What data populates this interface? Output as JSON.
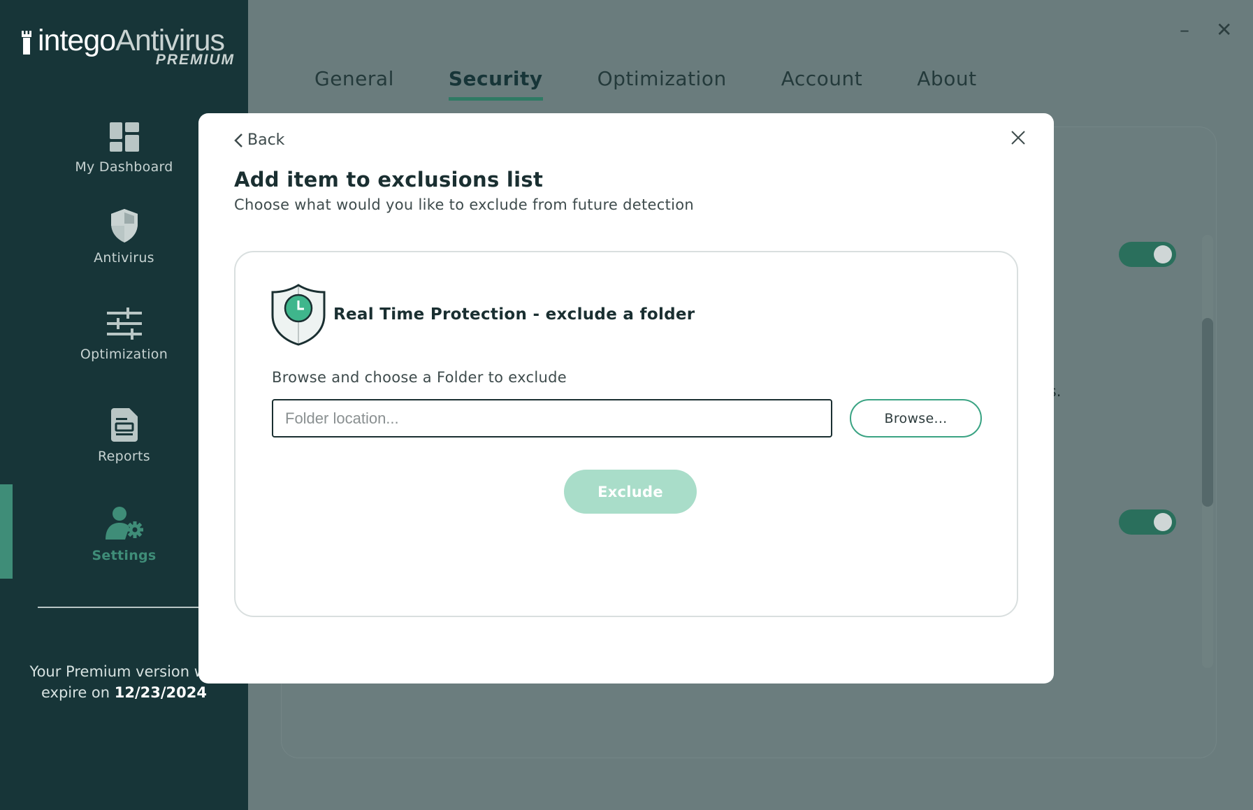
{
  "app": {
    "brand": "intego",
    "product": "Antivirus",
    "tier": "PREMIUM"
  },
  "sidebar": {
    "items": [
      {
        "label": "My Dashboard",
        "icon": "dashboard-grid-icon"
      },
      {
        "label": "Antivirus",
        "icon": "shield-icon"
      },
      {
        "label": "Optimization",
        "icon": "sliders-icon"
      },
      {
        "label": "Reports",
        "icon": "document-icon"
      },
      {
        "label": "Settings",
        "icon": "user-gear-icon"
      }
    ],
    "active": "Settings",
    "expiry_prefix": "Your Premium version will",
    "expiry_mid": "expire on",
    "expiry_date": "12/23/2024"
  },
  "window": {
    "minimize_glyph": "–",
    "close_glyph": "✕"
  },
  "tabs": [
    {
      "label": "General"
    },
    {
      "label": "Security"
    },
    {
      "label": "Optimization"
    },
    {
      "label": "Account"
    },
    {
      "label": "About"
    }
  ],
  "active_tab": "Security",
  "background": {
    "partial_text": "les.",
    "toggles": [
      true,
      true
    ]
  },
  "modal": {
    "back_label": "Back",
    "title": "Add item to exclusions list",
    "subtitle": "Choose what would you like to exclude from future detection",
    "card": {
      "title": "Real Time Protection - exclude a folder",
      "label": "Browse and choose a Folder to exclude",
      "input_value": "",
      "input_placeholder": "Folder location...",
      "browse_label": "Browse...",
      "exclude_label": "Exclude"
    }
  },
  "colors": {
    "sidebar_bg": "#173538",
    "accent": "#3f8d78",
    "overlay": "#6a7c7d",
    "exclude_disabled": "#a9ddc9"
  }
}
